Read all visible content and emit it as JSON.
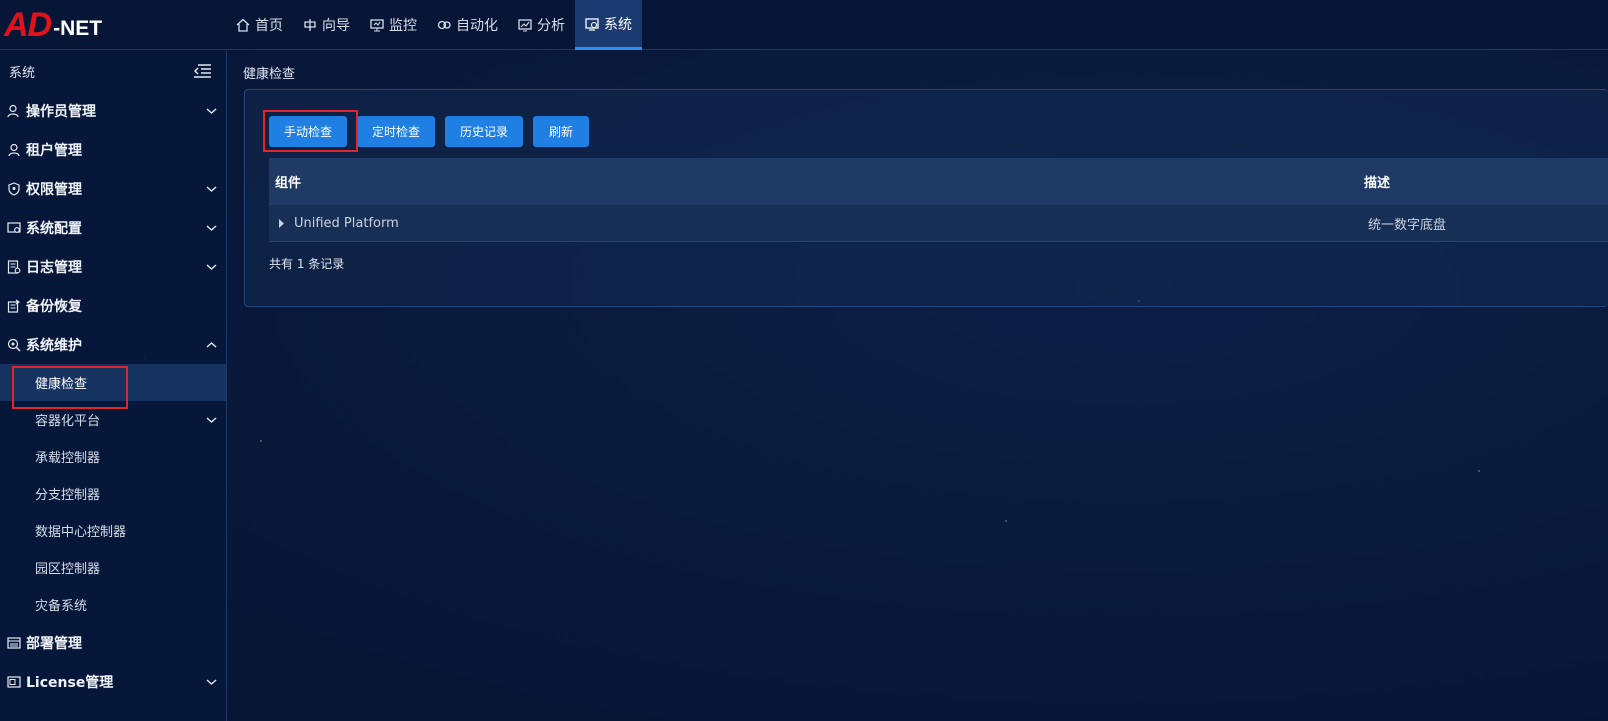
{
  "header": {
    "logo_ad": "AD",
    "logo_net": "-NET",
    "nav": [
      {
        "label": "首页",
        "icon": "home-icon"
      },
      {
        "label": "向导",
        "icon": "wizard-icon"
      },
      {
        "label": "监控",
        "icon": "monitor-icon"
      },
      {
        "label": "自动化",
        "icon": "automation-icon"
      },
      {
        "label": "分析",
        "icon": "analysis-icon"
      },
      {
        "label": "系统",
        "icon": "system-icon",
        "active": true
      }
    ]
  },
  "sidebar": {
    "title": "系统",
    "items": [
      {
        "label": "操作员管理",
        "icon": "operator-icon",
        "expandable": true
      },
      {
        "label": "租户管理",
        "icon": "tenant-icon"
      },
      {
        "label": "权限管理",
        "icon": "shield-icon",
        "expandable": true
      },
      {
        "label": "系统配置",
        "icon": "config-icon",
        "expandable": true
      },
      {
        "label": "日志管理",
        "icon": "log-icon",
        "expandable": true
      },
      {
        "label": "备份恢复",
        "icon": "backup-icon"
      },
      {
        "label": "系统维护",
        "icon": "maintenance-icon",
        "expanded": true
      }
    ],
    "sub_items": [
      {
        "label": "健康检查",
        "active": true
      },
      {
        "label": "容器化平台",
        "expandable": true
      },
      {
        "label": "承载控制器"
      },
      {
        "label": "分支控制器"
      },
      {
        "label": "数据中心控制器"
      },
      {
        "label": "园区控制器"
      },
      {
        "label": "灾备系统"
      }
    ],
    "bottom_items": [
      {
        "label": "部署管理",
        "icon": "deploy-icon"
      },
      {
        "label": "License管理",
        "icon": "license-icon",
        "expandable": true
      }
    ]
  },
  "main": {
    "breadcrumb": "健康检查",
    "buttons": {
      "manual": "手动检查",
      "scheduled": "定时检查",
      "history": "历史记录",
      "refresh": "刷新"
    },
    "table": {
      "columns": [
        "组件",
        "描述"
      ],
      "rows": [
        {
          "component": "Unified Platform",
          "description": "统一数字底盘"
        }
      ]
    },
    "record_count": "共有 1 条记录"
  },
  "colors": {
    "accent": "#1f7fe2",
    "highlight_box": "#e0262d",
    "logo_red": "#e2121b"
  }
}
